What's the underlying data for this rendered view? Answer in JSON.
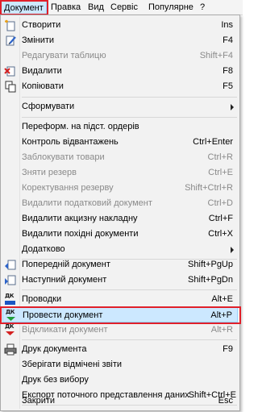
{
  "menubar": {
    "items": [
      {
        "label": "Документ"
      },
      {
        "label": "Правка"
      },
      {
        "label": "Вид"
      },
      {
        "label": "Сервіс"
      },
      {
        "label": "Популярне"
      },
      {
        "label": "?"
      }
    ]
  },
  "menu": {
    "items": [
      {
        "label": "Створити",
        "shortcut": "Ins",
        "icon": "new-document-icon"
      },
      {
        "label": "Змінити",
        "shortcut": "F4",
        "icon": "edit-icon"
      },
      {
        "label": "Редагувати таблицю",
        "shortcut": "Shift+F4",
        "icon": "",
        "disabled": true
      },
      {
        "label": "Видалити",
        "shortcut": "F8",
        "icon": "delete-icon"
      },
      {
        "label": "Копіювати",
        "shortcut": "F5",
        "icon": "copy-icon"
      },
      {
        "label": "Сформувати",
        "shortcut": "",
        "icon": ""
      },
      {
        "label": "Переформ. на підст. ордерів",
        "shortcut": "",
        "icon": ""
      },
      {
        "label": "Контроль відвантажень",
        "shortcut": "Ctrl+Enter",
        "icon": ""
      },
      {
        "label": "Заблокувати товари",
        "shortcut": "Ctrl+R",
        "icon": "",
        "disabled": true
      },
      {
        "label": "Зняти резерв",
        "shortcut": "Ctrl+E",
        "icon": "",
        "disabled": true
      },
      {
        "label": "Коректування резерву",
        "shortcut": "Shift+Ctrl+R",
        "icon": "",
        "disabled": true
      },
      {
        "label": "Видалити податковий документ",
        "shortcut": "Ctrl+D",
        "icon": "",
        "disabled": true
      },
      {
        "label": "Видалити акцизну накладну",
        "shortcut": "Ctrl+F",
        "icon": ""
      },
      {
        "label": "Видалити похідні документи",
        "shortcut": "Ctrl+X",
        "icon": ""
      },
      {
        "label": "Додатково",
        "shortcut": "",
        "icon": ""
      },
      {
        "label": "Попередній документ",
        "shortcut": "Shift+PgUp",
        "icon": "previous-document-icon"
      },
      {
        "label": "Наступний документ",
        "shortcut": "Shift+PgDn",
        "icon": "next-document-icon"
      },
      {
        "label": "Проводки",
        "shortcut": "Alt+E",
        "icon": "entries-icon"
      },
      {
        "label": "Провести документ",
        "shortcut": "Alt+P",
        "icon": "post-document-icon"
      },
      {
        "label": "Відкликати документ",
        "shortcut": "Alt+R",
        "icon": "recall-document-icon",
        "disabled": true
      },
      {
        "label": "Друк документа",
        "shortcut": "F9",
        "icon": "printer-icon"
      },
      {
        "label": "Зберігати відмічені звіти",
        "shortcut": "",
        "icon": ""
      },
      {
        "label": "Друк без вибору",
        "shortcut": "",
        "icon": ""
      },
      {
        "label": "Експорт поточного представлення даних",
        "shortcut": "Shift+Ctrl+E",
        "icon": ""
      },
      {
        "label": "Закрити",
        "shortcut": "Esc",
        "icon": ""
      }
    ]
  },
  "dk_icon_text": "ДК",
  "colors": {
    "highlight_border": "#e0202a",
    "hover_bg": "#cce8ff",
    "hover_border": "#99d1ff",
    "disabled_text": "#8a8a8a",
    "dk_green": "#1f9e3a",
    "dk_red": "#d42020",
    "dk_blue": "#1a56c4"
  }
}
